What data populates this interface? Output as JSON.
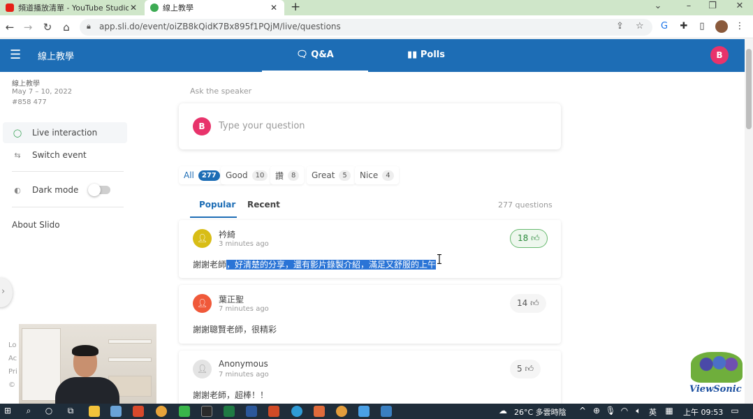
{
  "browser": {
    "tabs": [
      {
        "title": "頻道播放清單 - YouTube Studio",
        "favicon_color": "#e62117"
      },
      {
        "title": "線上教學",
        "favicon_color": "#3dab54"
      }
    ],
    "new_tab_label": "+",
    "window_controls": [
      "⌄",
      "–",
      "❐",
      "✕"
    ],
    "url": "app.sli.do/event/oiZB8kQidK7Bx895f1PQjM/live/questions"
  },
  "app": {
    "header_title": "線上教學",
    "tabs": [
      {
        "label": "Q&A"
      },
      {
        "label": "Polls"
      }
    ],
    "user_initial": "B"
  },
  "sidebar": {
    "event_name": "線上教學",
    "event_dates": "May 7 – 10, 2022",
    "event_code": "#858 477",
    "items": [
      {
        "label": "Live interaction"
      },
      {
        "label": "Switch event"
      }
    ],
    "dark_mode_label": "Dark mode",
    "about_label": "About Slido",
    "footer_fragments": [
      "Lo",
      "Ac",
      "Pri",
      "©"
    ]
  },
  "main": {
    "ask_label": "Ask the speaker",
    "ask_placeholder": "Type your question",
    "ask_initial": "B",
    "filters": [
      {
        "label": "All",
        "count": "277"
      },
      {
        "label": "Good",
        "count": "10"
      },
      {
        "label": "讚",
        "count": "8"
      },
      {
        "label": "Great",
        "count": "5"
      },
      {
        "label": "Nice",
        "count": "4"
      }
    ],
    "sort_tabs": [
      "Popular",
      "Recent"
    ],
    "question_count": "277 questions",
    "questions": [
      {
        "author": "衿綺",
        "time": "3 minutes ago",
        "text_plain": "謝謝老師",
        "text_selected": "，好清楚的分享，還有影片錄製介紹，滿足又舒服的上午",
        "likes": "18",
        "avatar_color": "#d8bd16"
      },
      {
        "author": "葉正聖",
        "time": "7 minutes ago",
        "text_plain": "謝謝聰賢老師，很精彩",
        "text_selected": "",
        "likes": "14",
        "avatar_color": "#f0593a"
      },
      {
        "author": "Anonymous",
        "time": "7 minutes ago",
        "text_plain": "謝謝老師，超棒！！",
        "text_selected": "",
        "likes": "5",
        "avatar_color": "#e4e4e4"
      }
    ]
  },
  "overlay": {
    "brand": "ViewSonic"
  },
  "taskbar": {
    "weather": "26°C 多雲時陰",
    "ime": "英",
    "clock": "上午 09:53"
  },
  "colors": {
    "header_blue": "#1d6db5",
    "accent_pink": "#e8336b",
    "tab_strip": "#cfe6c9",
    "taskbar": "#1f2d3a"
  }
}
